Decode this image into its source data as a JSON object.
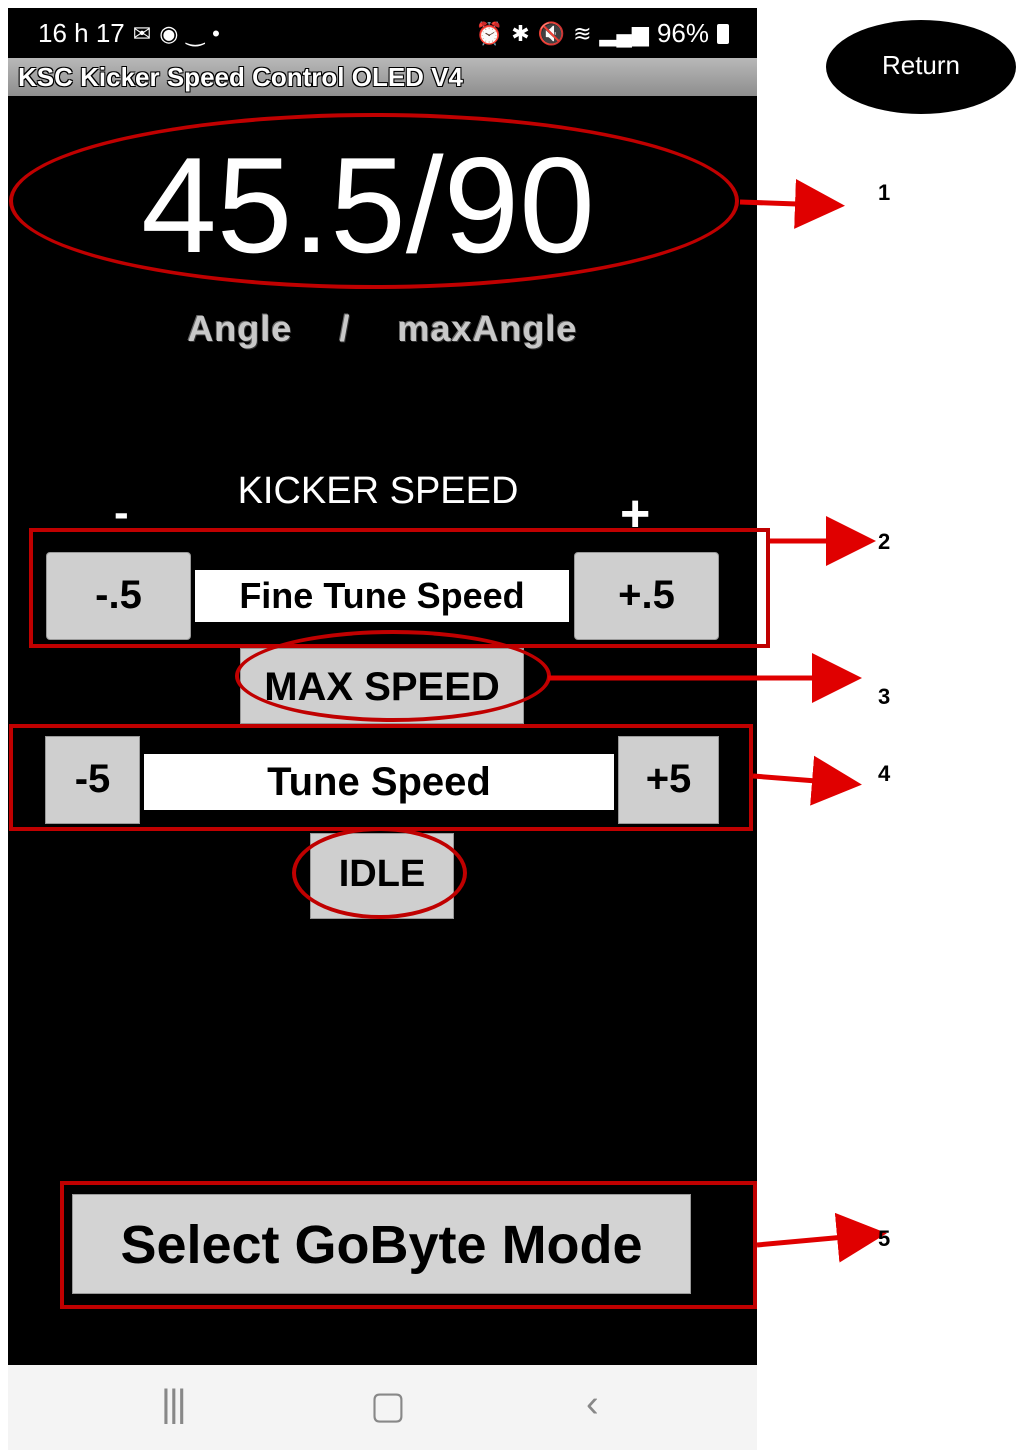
{
  "status": {
    "time": "16 h 17",
    "left_icons": [
      "gmail-icon",
      "messenger-icon",
      "arc-icon",
      "dot-icon"
    ],
    "right_icons": [
      "alarm-icon",
      "bluetooth-icon",
      "mute-icon",
      "wifi-icon",
      "signal-icon"
    ],
    "battery": "96%"
  },
  "app": {
    "title": "KSC Kicker Speed Control OLED  V4"
  },
  "display": {
    "angle_value": "45.5/90",
    "caption_left": "Angle",
    "caption_sep": "/",
    "caption_right": "maxAngle"
  },
  "controls": {
    "kicker_label": "KICKER SPEED",
    "minus_symbol": "-",
    "plus_symbol": "+",
    "fine_minus": "-.5",
    "fine_label": "Fine Tune Speed",
    "fine_plus": "+.5",
    "max_speed": "MAX SPEED",
    "tune_minus": "-5",
    "tune_label": "Tune Speed",
    "tune_plus": "+5",
    "idle": "IDLE",
    "gobyte": "Select GoByte Mode"
  },
  "return_label": "Return",
  "callouts": [
    "1",
    "2",
    "3",
    "4",
    "5"
  ],
  "annotation_color": "#c00000",
  "nav_icons": [
    "recent-apps-icon",
    "home-icon",
    "back-icon"
  ]
}
